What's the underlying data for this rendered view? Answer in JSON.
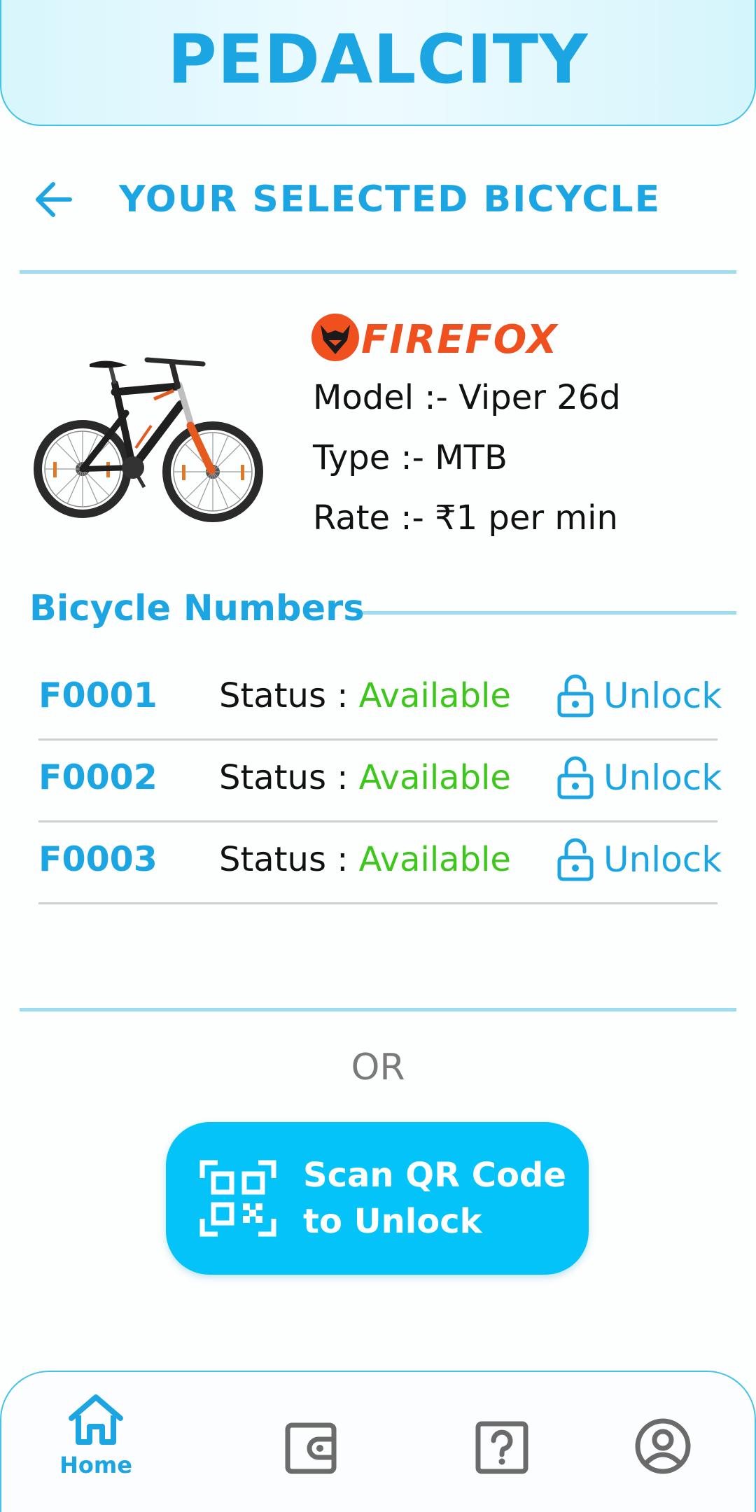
{
  "header": {
    "app_title": "PEDALCITY"
  },
  "page": {
    "title": "YOUR SELECTED BICYCLE"
  },
  "bicycle": {
    "brand": "FIREFOX",
    "model_line": "Model :-  Viper 26d",
    "type_line": "Type :-  MTB",
    "rate_line": "Rate :-  ₹1 per min"
  },
  "numbers": {
    "heading": "Bicycle Numbers",
    "rows": [
      {
        "id": "F0001",
        "status_label": "Status : ",
        "status_value": "Available",
        "action": "Unlock"
      },
      {
        "id": "F0002",
        "status_label": "Status : ",
        "status_value": "Available",
        "action": "Unlock"
      },
      {
        "id": "F0003",
        "status_label": "Status : ",
        "status_value": "Available",
        "action": "Unlock"
      }
    ]
  },
  "or_text": "OR",
  "scan_button": {
    "line1": "Scan QR Code",
    "line2": "to Unlock",
    "icon": "qr-code-icon"
  },
  "bottom_nav": {
    "items": [
      {
        "label": "Home",
        "icon": "home-icon",
        "active": true
      },
      {
        "label": "",
        "icon": "wallet-icon",
        "active": false
      },
      {
        "label": "",
        "icon": "help-icon",
        "active": false
      },
      {
        "label": "",
        "icon": "profile-icon",
        "active": false
      }
    ]
  },
  "colors": {
    "primary": "#1ba5e2",
    "button": "#04c3f9",
    "available": "#3cc71a",
    "brand_orange": "#f0501e",
    "nav_icon_inactive": "#6b6b6b"
  }
}
